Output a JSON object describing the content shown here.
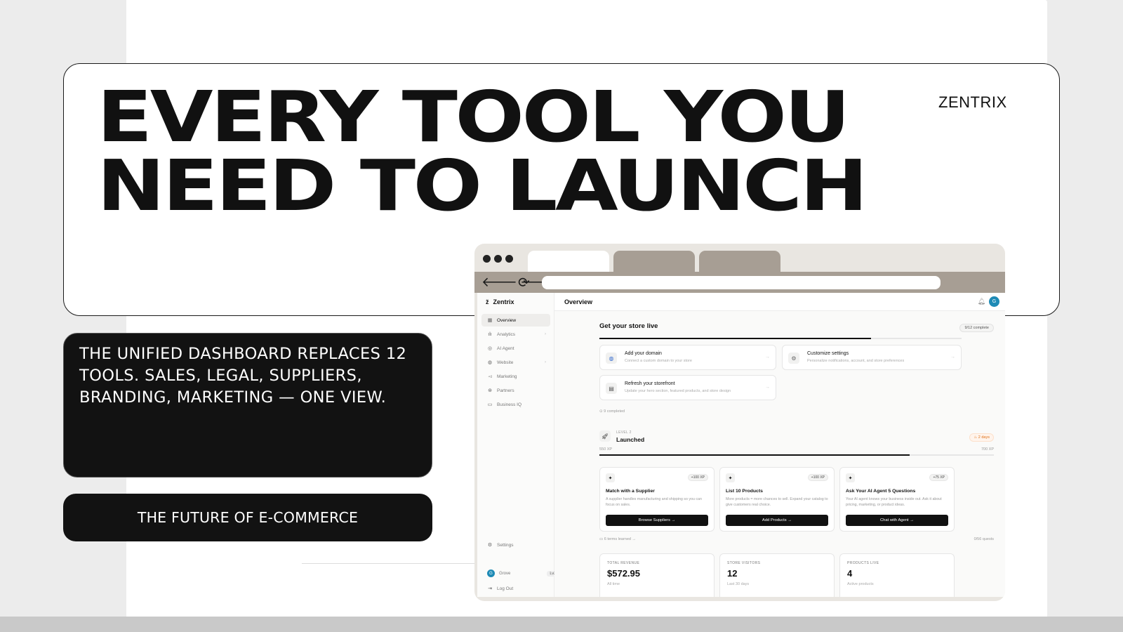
{
  "hero": {
    "headline_line1": "EVERY TOOL YOU",
    "headline_line2": "NEED TO LAUNCH",
    "brand": "ZENTRIX"
  },
  "description": "THE UNIFIED DASHBOARD REPLACES 12 TOOLS. SALES, LEGAL, SUPPLIERS, BRANDING, MARKETING — ONE VIEW.",
  "tagline": "THE FUTURE OF E-COMMERCE",
  "app": {
    "logo_text": "Zentrix",
    "page_title": "Overview",
    "avatar_initial": "G",
    "sidebar": {
      "items": [
        {
          "label": "Overview",
          "icon": "grid-icon"
        },
        {
          "label": "Analytics",
          "icon": "bar-chart-icon"
        },
        {
          "label": "AI Agent",
          "icon": "bot-icon"
        },
        {
          "label": "Website",
          "icon": "globe-icon"
        },
        {
          "label": "Marketing",
          "icon": "megaphone-icon"
        },
        {
          "label": "Partners",
          "icon": "handshake-icon"
        },
        {
          "label": "Business IQ",
          "icon": "book-icon"
        }
      ],
      "settings_label": "Settings",
      "user_name": "Grove",
      "user_level": "Lv2",
      "logout_label": "Log Out"
    },
    "setup": {
      "title": "Get your store live",
      "progress_label": "9/12 complete",
      "progress_fraction": 0.75,
      "tasks": [
        {
          "title": "Add your domain",
          "sub": "Connect a custom domain to your store"
        },
        {
          "title": "Customize settings",
          "sub": "Personalize notifications, account, and store preferences"
        },
        {
          "title": "Refresh your storefront",
          "sub": "Update your hero section, featured products, and store design"
        }
      ],
      "completed_note": "9 completed"
    },
    "level": {
      "tag": "LEVEL 2",
      "name": "Launched",
      "streak": "2 days",
      "xp_current": "550 XP",
      "xp_target": "700 XP",
      "xp_fraction": 0.7857
    },
    "quests": [
      {
        "title": "Match with a Supplier",
        "xp": "+100 XP",
        "desc": "A supplier handles manufacturing and shipping so you can focus on sales.",
        "button": "Browse Suppliers →"
      },
      {
        "title": "List 10 Products",
        "xp": "+100 XP",
        "desc": "More products = more chances to sell. Expand your catalog to give customers real choice.",
        "button": "Add Products →"
      },
      {
        "title": "Ask Your AI Agent 5 Questions",
        "xp": "+75 XP",
        "desc": "Your AI agent knows your business inside out. Ask it about pricing, marketing, or product ideas.",
        "button": "Chat with Agent →"
      }
    ],
    "terms_learned": "6 terms learned",
    "quests_count": "0/56 quests",
    "stats": [
      {
        "label": "TOTAL REVENUE",
        "value": "$572.95",
        "sub": "All time"
      },
      {
        "label": "STORE VISITORS",
        "value": "12",
        "sub": "Last 30 days"
      },
      {
        "label": "PRODUCTS LIVE",
        "value": "4",
        "sub": "Active products"
      }
    ]
  }
}
